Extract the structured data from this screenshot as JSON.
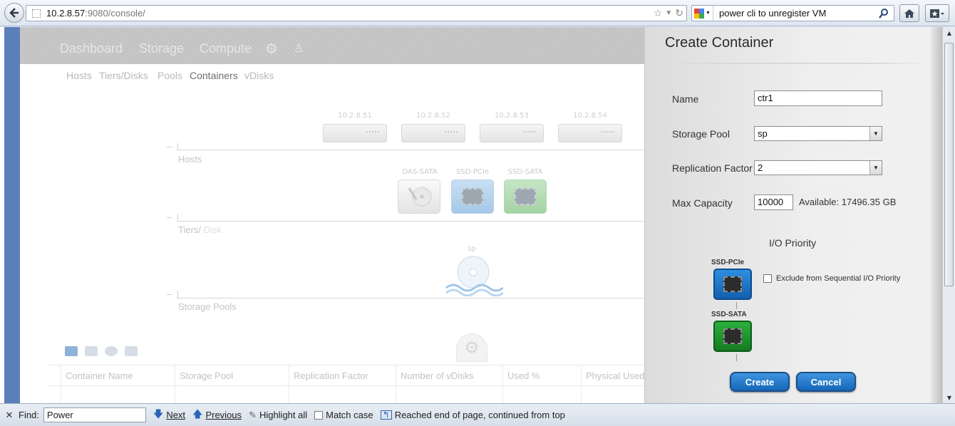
{
  "browser": {
    "url_host": "10.2.8.57",
    "url_rest": ":9080/console/",
    "search_query": "power cli to unregister VM"
  },
  "dashboard": {
    "nav": [
      "Dashboard",
      "Storage",
      "Compute"
    ],
    "subnav": [
      "Hosts",
      "Tiers/Disks",
      "Pools",
      "Containers",
      "vDisks"
    ],
    "hosts": [
      "10.2.8.51",
      "10.2.8.52",
      "10.2.8.53",
      "10.2.8.54"
    ],
    "sections": {
      "hosts": "Hosts",
      "tiers_prefix": "Tiers/",
      "tiers_suffix": " Disk",
      "pools": "Storage Pools"
    },
    "tiers": [
      "DAS-SATA",
      "SSD-PCIe",
      "SSD-SATA"
    ],
    "pool_name": "sp",
    "table_headers": [
      "Container Name",
      "Storage Pool",
      "Replication Factor",
      "Number of vDisks",
      "Used %",
      "Physical Used"
    ]
  },
  "dialog": {
    "title": "Create Container",
    "name_label": "Name",
    "name_value": "ctr1",
    "pool_label": "Storage Pool",
    "pool_value": "sp",
    "rf_label": "Replication Factor",
    "rf_value": "2",
    "capacity_label": "Max Capacity",
    "capacity_value": "10000",
    "available_text": "Available: 17496.35 GB",
    "io_title": "I/O Priority",
    "tier1": "SSD-PCIe",
    "tier2": "SSD-SATA",
    "exclude_label": "Exclude from Sequential I/O Priority",
    "create_label": "Create",
    "cancel_label": "Cancel"
  },
  "findbar": {
    "label": "Find:",
    "query": "Power",
    "next": "Next",
    "previous": "Previous",
    "highlight_all": "Highlight all",
    "match_case": "Match case",
    "status": "Reached end of page, continued from top"
  },
  "colors": {
    "button_blue": "#1566b8",
    "pcie_blue": "#1a74c9",
    "sata_green": "#1d8f2c"
  }
}
